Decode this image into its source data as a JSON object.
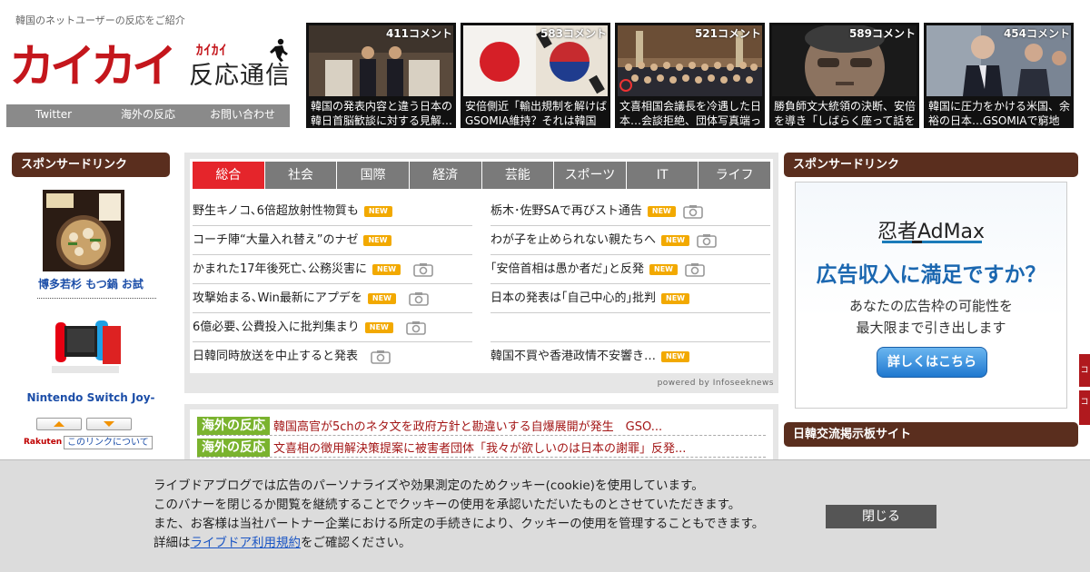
{
  "site": {
    "tagline": "韓国のネットユーザーの反応をご紹介",
    "logo_main": "カイカイ",
    "logo_kana": "ｶｲｶｲ",
    "logo_sub": "反応通信",
    "brand_color": "#c4161c"
  },
  "topnav": {
    "items": [
      {
        "label": "Twitter"
      },
      {
        "label": "海外の反応"
      },
      {
        "label": "お問い合わせ"
      }
    ]
  },
  "featured": [
    {
      "count": "411コメント",
      "title": "韓国の発表内容と違う日本の韓日首脳歓談に対する見解…"
    },
    {
      "count": "583コメント",
      "title": "安倍側近「輸出規制を解けばGSOMIA維持？それは韓国側"
    },
    {
      "count": "521コメント",
      "title": "文喜相国会議長を冷遇した日本…会談拒絶、団体写真端っ"
    },
    {
      "count": "589コメント",
      "title": "勝負師文大統領の決断、安倍を導き「しばらく座って話を"
    },
    {
      "count": "454コメント",
      "title": "韓国に圧力をかける米国、余裕の日本…GSOMIAで窮地に"
    }
  ],
  "left_sidebar": {
    "heading": "スポンサードリンク",
    "ads": [
      {
        "label": "博多若杉 もつ鍋 お試"
      },
      {
        "label": "Nintendo Switch Joy-"
      }
    ],
    "rakuten": "Rakuten",
    "about_link": "このリンクについて"
  },
  "news": {
    "tabs": [
      {
        "label": "総合",
        "active": true
      },
      {
        "label": "社会"
      },
      {
        "label": "国際"
      },
      {
        "label": "経済"
      },
      {
        "label": "芸能"
      },
      {
        "label": "スポーツ"
      },
      {
        "label": "IT"
      },
      {
        "label": "ライフ"
      }
    ],
    "new_badge": "NEW",
    "left": [
      {
        "text": "野生キノコ､6倍超放射性物質も"
      },
      {
        "text": "コーチ陣“大量入れ替え”のナゼ"
      },
      {
        "text": "かまれた17年後死亡､公務災害に"
      },
      {
        "text": "攻撃始まる､Win最新にアプデを"
      },
      {
        "text": "6億必要､公費投入に批判集まり"
      },
      {
        "text": "日韓同時放送を中止すると発表"
      }
    ],
    "right": [
      {
        "text": "栃木･佐野SAで再びスト通告"
      },
      {
        "text": "わが子を止められない親たちへ"
      },
      {
        "text": "｢安倍首相は愚か者だ｣と反発"
      },
      {
        "text": "日本の発表は｢自己中心的｣批判"
      },
      {
        "text": ""
      },
      {
        "text": "韓国不買や香港政情不安響き…"
      }
    ],
    "powered": "powered by Infoseeknews"
  },
  "overseas": {
    "tag": "海外の反応",
    "items": [
      {
        "text": "韓国高官が5chのネタ文を政府方針と勘違いする自爆展開が発生　GSO..."
      },
      {
        "text": "文喜相の徴用解決策提案に被害者団体「我々が欲しいのは日本の謝罪」反発..."
      }
    ]
  },
  "right_sidebar": {
    "heading": "スポンサードリンク",
    "ad": {
      "logo": "忍者AdMax",
      "headline": "広告収入に満足ですか？",
      "body_line1": "あなたの広告枠の可能性を",
      "body_line2": "最大限まで引き出します",
      "button": "詳しくはこちら"
    },
    "heading2": "日韓交流掲示板サイト"
  },
  "edge_tabs": [
    "コ",
    "コ"
  ],
  "cookie": {
    "line1": "ライブドアブログでは広告のパーソナライズや効果測定のためクッキー(cookie)を使用しています。",
    "line2": "このバナーを閉じるか閲覧を継続することでクッキーの使用を承認いただいたものとさせていただきます。",
    "line3": "また、お客様は当社パートナー企業における所定の手続きにより、クッキーの使用を管理することもできます。",
    "line4_prefix": "詳細は",
    "line4_link": "ライブドア利用規約",
    "line4_suffix": "をご確認ください。",
    "close": "閉じる"
  }
}
